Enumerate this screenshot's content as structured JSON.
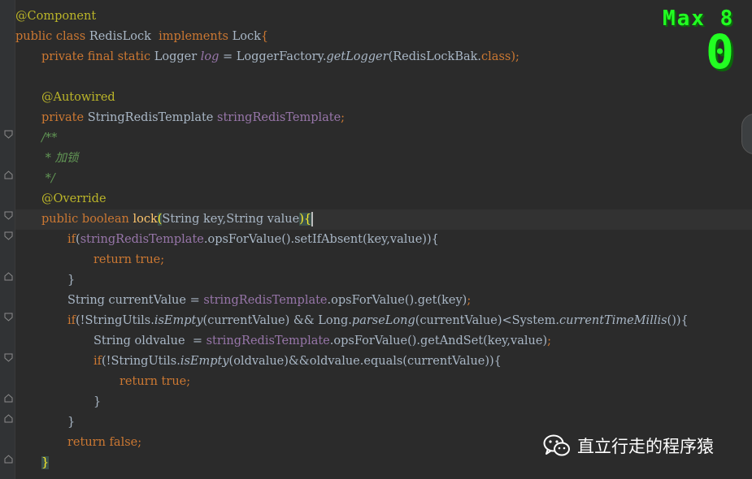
{
  "overlay": {
    "max_label": "Max 8",
    "value": "0"
  },
  "watermark": {
    "text": "直立行走的程序猿",
    "icon": "wechat-icon"
  },
  "code": {
    "l1": "@Component",
    "l2_kw1": "public class ",
    "l2_name": "RedisLock  ",
    "l2_kw2": "implements ",
    "l2_iface": "Lock",
    "l2_brace": "{",
    "l3_kw": "private final static ",
    "l3_type": "Logger ",
    "l3_field": "log",
    "l3_eq": " = LoggerFactory.",
    "l3_method": "getLogger",
    "l3_args": "(RedisLockBak.",
    "l3_class": "class",
    "l3_end": ");",
    "l5_ann": "@Autowired",
    "l6_kw": "private ",
    "l6_type": "StringRedisTemplate ",
    "l6_field": "stringRedisTemplate",
    "l6_end": ";",
    "l7": "/**",
    "l8": " * 加锁",
    "l9": " */",
    "l10": "@Override",
    "l11_kw": "public boolean ",
    "l11_fn": "lock",
    "l11_paren": "(",
    "l11_params": "String key,String value",
    "l11_close": ")",
    "l11_brace": "{",
    "l12_kw": "if",
    "l12_open": "(",
    "l12_field": "stringRedisTemplate",
    "l12_rest": ".opsForValue().setIfAbsent(key,value)){",
    "l13_kw": "return true",
    "l13_end": ";",
    "l14": "}",
    "l15_a": "String currentValue = ",
    "l15_field": "stringRedisTemplate",
    "l15_rest": ".opsForValue().get(key)",
    "l15_end": ";",
    "l16_kw": "if",
    "l16_a": "(!StringUtils.",
    "l16_m1": "isEmpty",
    "l16_b": "(currentValue) && Long.",
    "l16_m2": "parseLong",
    "l16_c": "(currentValue)<System.",
    "l16_m3": "currentTimeMillis",
    "l16_d": "()){",
    "l17_a": "String oldvalue  = ",
    "l17_field": "stringRedisTemplate",
    "l17_rest": ".opsForValue().getAndSet(key,value)",
    "l17_end": ";",
    "l18_kw": "if",
    "l18_a": "(!StringUtils.",
    "l18_m": "isEmpty",
    "l18_b": "(oldvalue)&&oldvalue.equals(currentValue)){",
    "l19_kw": "return true",
    "l19_end": ";",
    "l20": "}",
    "l21": "}",
    "l22_kw": "return false",
    "l22_end": ";",
    "l23": "}"
  }
}
